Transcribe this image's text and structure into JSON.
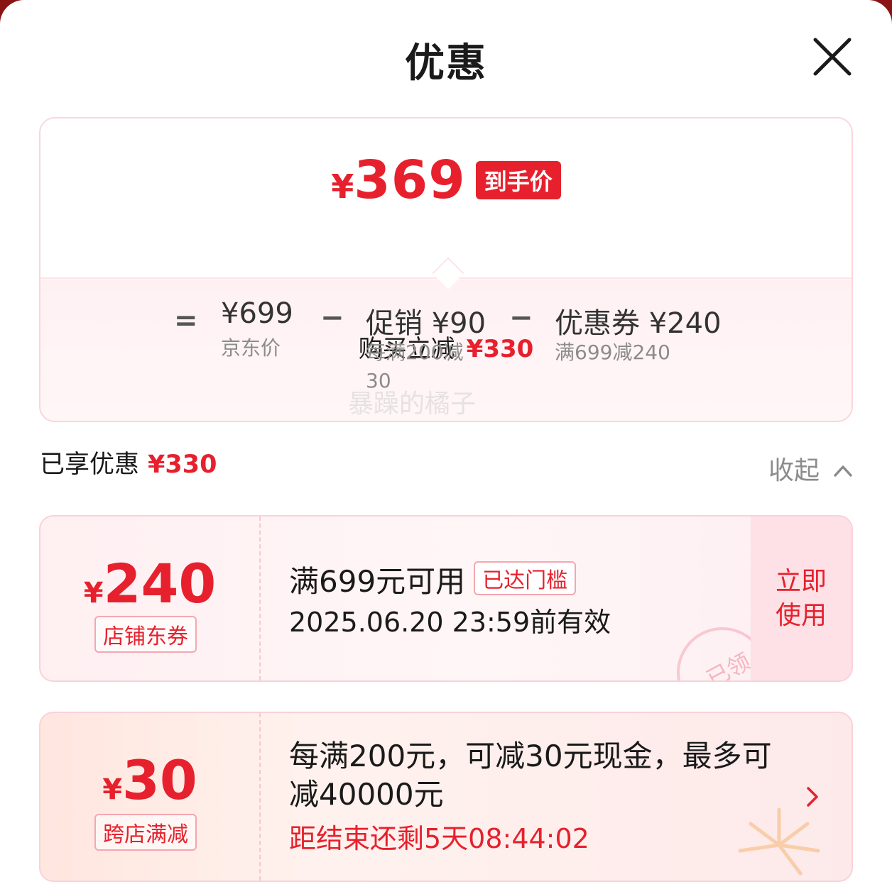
{
  "header": {
    "title": "优惠"
  },
  "summary": {
    "currency": "¥",
    "final_price": "369",
    "final_badge": "到手价",
    "reduce_label": "购买立减",
    "reduce_amount": "¥330",
    "breakdown": {
      "eq": "=",
      "jd_price": "¥699",
      "jd_label": "京东价",
      "minus": "−",
      "promo_label": "促销",
      "promo_amount": "¥90",
      "promo_desc_line1": "每满200减",
      "promo_desc_line2": "30",
      "coupon_label": "优惠券",
      "coupon_amount": "¥240",
      "coupon_desc": "满699减240"
    },
    "watermark": "暴躁的橘子"
  },
  "enjoyed": {
    "label": "已享优惠",
    "amount": "¥330",
    "collapse_label": "收起"
  },
  "coupons": [
    {
      "currency": "¥",
      "amount": "240",
      "tag": "店铺东券",
      "title": "满699元可用",
      "threshold_badge": "已达门槛",
      "validity": "2025.06.20 23:59前有效",
      "action_line1": "立即",
      "action_line2": "使用",
      "stamp": "已领"
    },
    {
      "currency": "¥",
      "amount": "30",
      "tag": "跨店满减",
      "description": "每满200元，可减30元现金，最多可减40000元",
      "countdown": "距结束还剩5天08:44:02"
    }
  ],
  "colors": {
    "accent": "#e6212d",
    "border": "#f9d2d8",
    "muted": "#8c8c8c"
  },
  "icons": {
    "close": "close-icon",
    "collapse": "chevron-up-icon",
    "detail": "chevron-right-icon"
  }
}
